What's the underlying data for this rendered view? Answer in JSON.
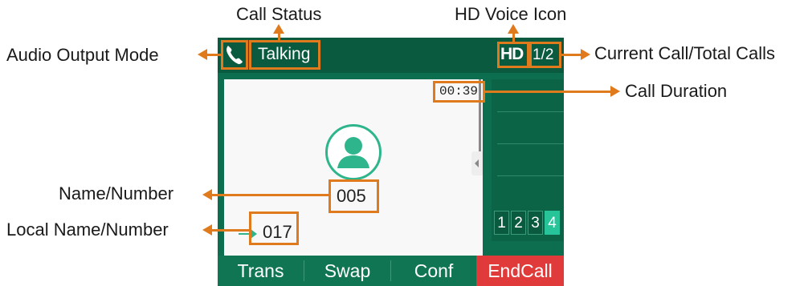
{
  "annotations": {
    "call_status": "Call Status",
    "hd_voice_icon": "HD Voice Icon",
    "audio_output_mode": "Audio Output Mode",
    "current_total_calls": "Current Call/Total Calls",
    "call_duration": "Call Duration",
    "name_number": "Name/Number",
    "local_name_number": "Local Name/Number"
  },
  "colors": {
    "callout_orange": "#e07b1d",
    "screen_green": "#0d6e4f",
    "accent_teal": "#27c49a",
    "endcall_red": "#e03a3a"
  },
  "status_bar": {
    "audio_icon": "handset-icon",
    "status": "Talking",
    "hd_label": "HD",
    "call_count": "1/2"
  },
  "call": {
    "duration": "00:39",
    "avatar_icon": "contact-avatar-icon",
    "name_number": "005",
    "local_number": "017"
  },
  "line_keys": [
    {
      "label": "1",
      "active": false
    },
    {
      "label": "2",
      "active": false
    },
    {
      "label": "3",
      "active": false
    },
    {
      "label": "4",
      "active": true
    }
  ],
  "softkeys": [
    "Trans",
    "Swap",
    "Conf",
    "EndCall"
  ]
}
